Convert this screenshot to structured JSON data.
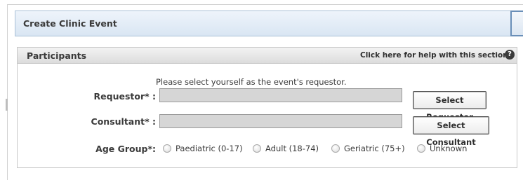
{
  "header": {
    "title": "Create Clinic Event"
  },
  "participants": {
    "title": "Participants",
    "help_link": "Click here for help with this section",
    "help_icon": "?",
    "instruction": "Please select yourself as the event's requestor.",
    "requestor": {
      "label": "Requestor* :",
      "value": "",
      "button": "Select Requestor"
    },
    "consultant": {
      "label": "Consultant* :",
      "value": "",
      "button": "Select Consultant"
    },
    "age_group": {
      "label": "Age Group*:",
      "options": [
        "Paediatric (0-17)",
        "Adult (18-74)",
        "Geriatric (75+)",
        "Unknown"
      ],
      "selected": null
    }
  }
}
